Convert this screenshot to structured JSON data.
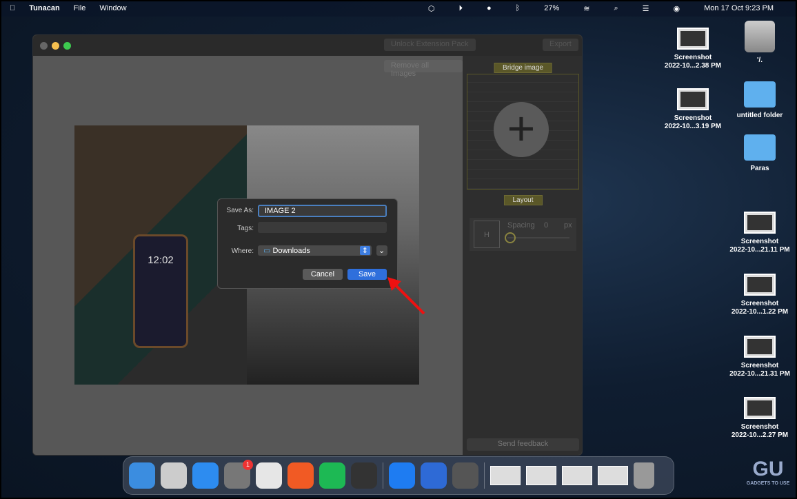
{
  "menubar": {
    "app": "Tunacan",
    "items": [
      "File",
      "Window"
    ],
    "battery": "27%",
    "datetime": "Mon 17 Oct  9:23 PM"
  },
  "window": {
    "unlock": "Unlock Extension Pack",
    "export": "Export",
    "remove_all": "Remove all Images",
    "bridge": "Bridge image",
    "layout": "Layout",
    "spacing_label": "Spacing",
    "spacing_value": "0",
    "spacing_unit": "px",
    "feedback": "Send feedback",
    "slider_value": 0,
    "phone_time": "12:02"
  },
  "dialog": {
    "save_as_label": "Save As:",
    "save_as_value": "IMAGE 2",
    "tags_label": "Tags:",
    "tags_value": "",
    "where_label": "Where:",
    "where_value": "Downloads",
    "cancel": "Cancel",
    "save": "Save"
  },
  "desktop": [
    {
      "kind": "thumb",
      "l1": "Screenshot",
      "l2": "2022-10...2.38 PM"
    },
    {
      "kind": "drive",
      "l1": "'/.",
      "l2": ""
    },
    {
      "kind": "thumb",
      "l1": "Screenshot",
      "l2": "2022-10...3.19 PM"
    },
    {
      "kind": "folder",
      "l1": "untitled folder",
      "l2": ""
    },
    {
      "kind": "folder",
      "l1": "Paras",
      "l2": ""
    },
    {
      "kind": "thumb",
      "l1": "Screenshot",
      "l2": "2022-10...21.11 PM"
    },
    {
      "kind": "thumb",
      "l1": "Screenshot",
      "l2": "2022-10...1.22 PM"
    },
    {
      "kind": "thumb",
      "l1": "Screenshot",
      "l2": "2022-10...21.31 PM"
    },
    {
      "kind": "thumb",
      "l1": "Screenshot",
      "l2": "2022-10...2.27 PM"
    }
  ],
  "dock": {
    "apps": [
      {
        "name": "finder",
        "color": "#3b8de0"
      },
      {
        "name": "launchpad",
        "color": "#ccc"
      },
      {
        "name": "safari",
        "color": "#2d8cf0"
      },
      {
        "name": "system-preferences",
        "color": "#777",
        "badge": "1"
      },
      {
        "name": "chrome",
        "color": "#e6e6e6"
      },
      {
        "name": "brave",
        "color": "#f15a24"
      },
      {
        "name": "spotify",
        "color": "#1db954"
      },
      {
        "name": "app-ring",
        "color": "#333"
      },
      {
        "name": "app-store",
        "color": "#1e7cf2"
      },
      {
        "name": "app-face",
        "color": "#2e6ad6"
      },
      {
        "name": "app-wave",
        "color": "#555"
      }
    ]
  },
  "watermark": {
    "text": "GU",
    "sub": "GADGETS TO USE"
  }
}
